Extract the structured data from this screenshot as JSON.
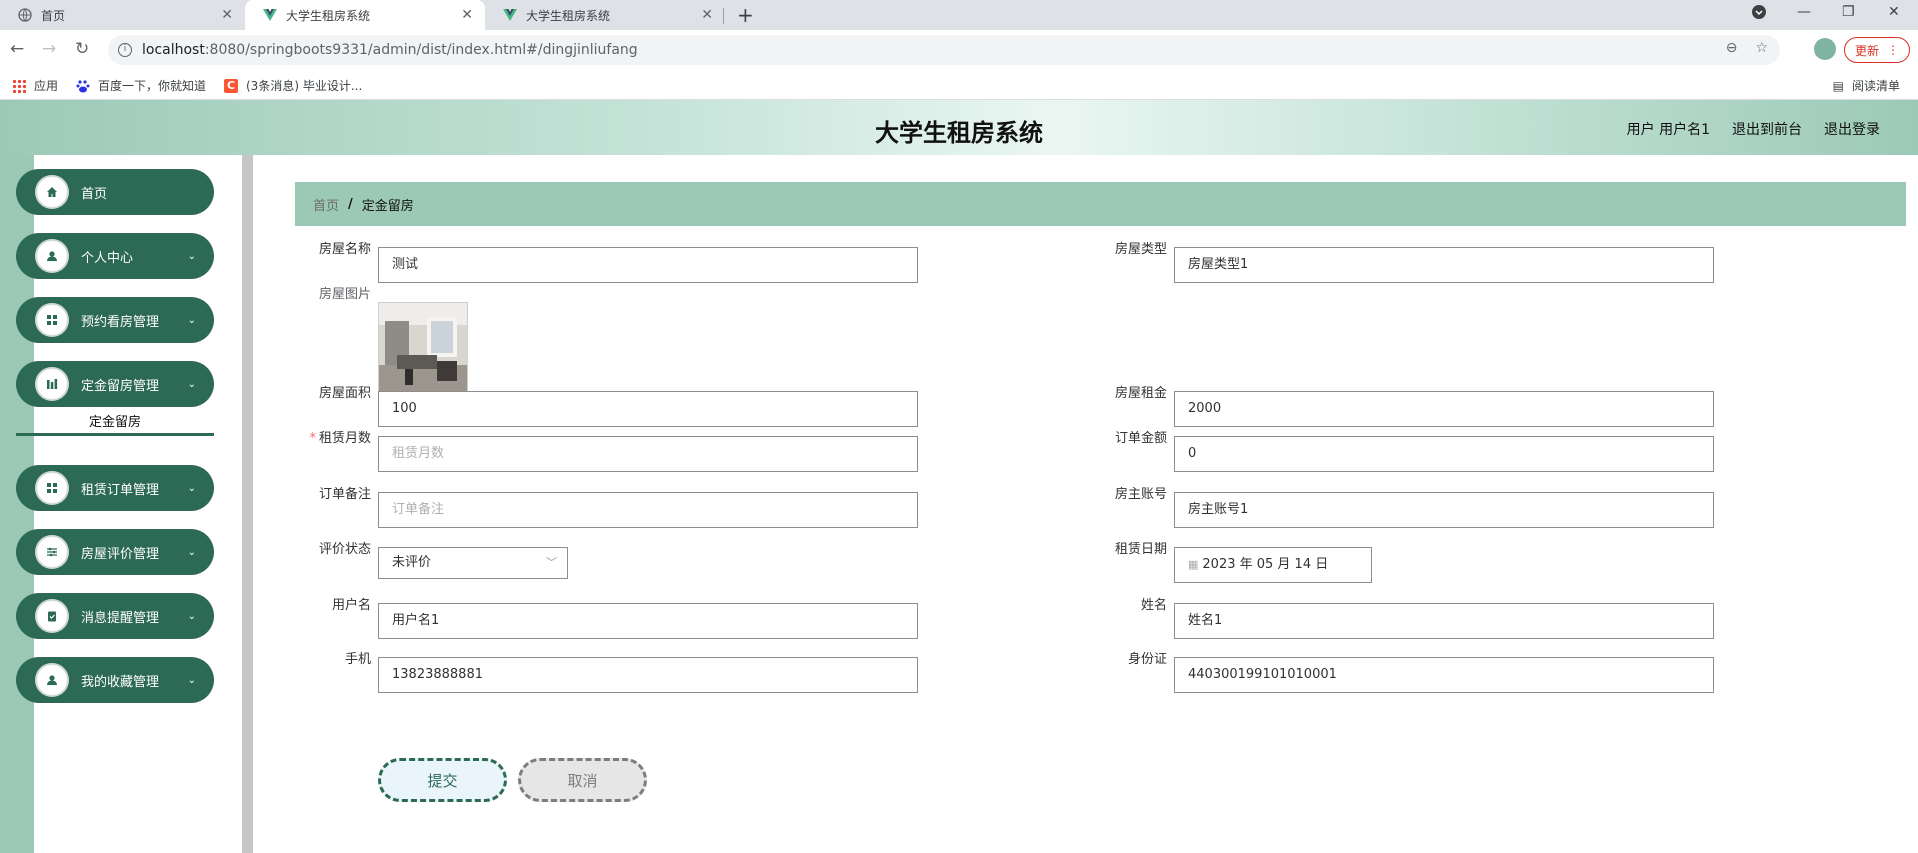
{
  "browser": {
    "tabs": [
      {
        "title": "首页"
      },
      {
        "title": "大学生租房系统"
      },
      {
        "title": "大学生租房系统"
      }
    ],
    "url_host": "localhost",
    "url_path": ":8080/springboots9331/admin/dist/index.html#/dingjinliufang",
    "update_label": "更新",
    "bookmarks": [
      "应用",
      "百度一下，你就知道",
      "(3条消息) 毕业设计..."
    ],
    "reading_list": "阅读清单"
  },
  "header": {
    "title": "大学生租房系统",
    "user_text": "用户 用户名1",
    "to_front": "退出到前台",
    "logout": "退出登录"
  },
  "sidebar": {
    "items": [
      {
        "label": "首页",
        "icon": "home-icon"
      },
      {
        "label": "个人中心",
        "icon": "person-icon"
      },
      {
        "label": "预约看房管理",
        "icon": "grid-icon"
      },
      {
        "label": "定金留房管理",
        "icon": "chart-icon"
      },
      {
        "label": "租赁订单管理",
        "icon": "grid-icon"
      },
      {
        "label": "房屋评价管理",
        "icon": "sliders-icon"
      },
      {
        "label": "消息提醒管理",
        "icon": "clipboard-icon"
      },
      {
        "label": "我的收藏管理",
        "icon": "person-icon"
      }
    ],
    "submenu": "定金留房"
  },
  "breadcrumb": {
    "home": "首页",
    "sep": "/",
    "current": "定金留房"
  },
  "form": {
    "house_name": {
      "label": "房屋名称",
      "value": "测试"
    },
    "house_type": {
      "label": "房屋类型",
      "value": "房屋类型1"
    },
    "house_image": {
      "label": "房屋图片"
    },
    "house_area": {
      "label": "房屋面积",
      "value": "100"
    },
    "house_rent": {
      "label": "房屋租金",
      "value": "2000"
    },
    "rent_months": {
      "label": "租赁月数",
      "placeholder": "租赁月数",
      "required": "*"
    },
    "order_amount": {
      "label": "订单金额",
      "value": "0"
    },
    "order_note": {
      "label": "订单备注",
      "placeholder": "订单备注"
    },
    "landlord_account": {
      "label": "房主账号",
      "value": "房主账号1"
    },
    "review_status": {
      "label": "评价状态",
      "value": "未评价"
    },
    "rent_date": {
      "label": "租赁日期",
      "value": "2023 年 05 月 14 日"
    },
    "username": {
      "label": "用户名",
      "value": "用户名1"
    },
    "name": {
      "label": "姓名",
      "value": "姓名1"
    },
    "phone": {
      "label": "手机",
      "value": "13823888881"
    },
    "id_card": {
      "label": "身份证",
      "value": "440300199101010001"
    },
    "submit": "提交",
    "cancel": "取消"
  },
  "colors": {
    "primary": "#2d6a55",
    "breadcrumb_bg": "#9cc9b6"
  }
}
